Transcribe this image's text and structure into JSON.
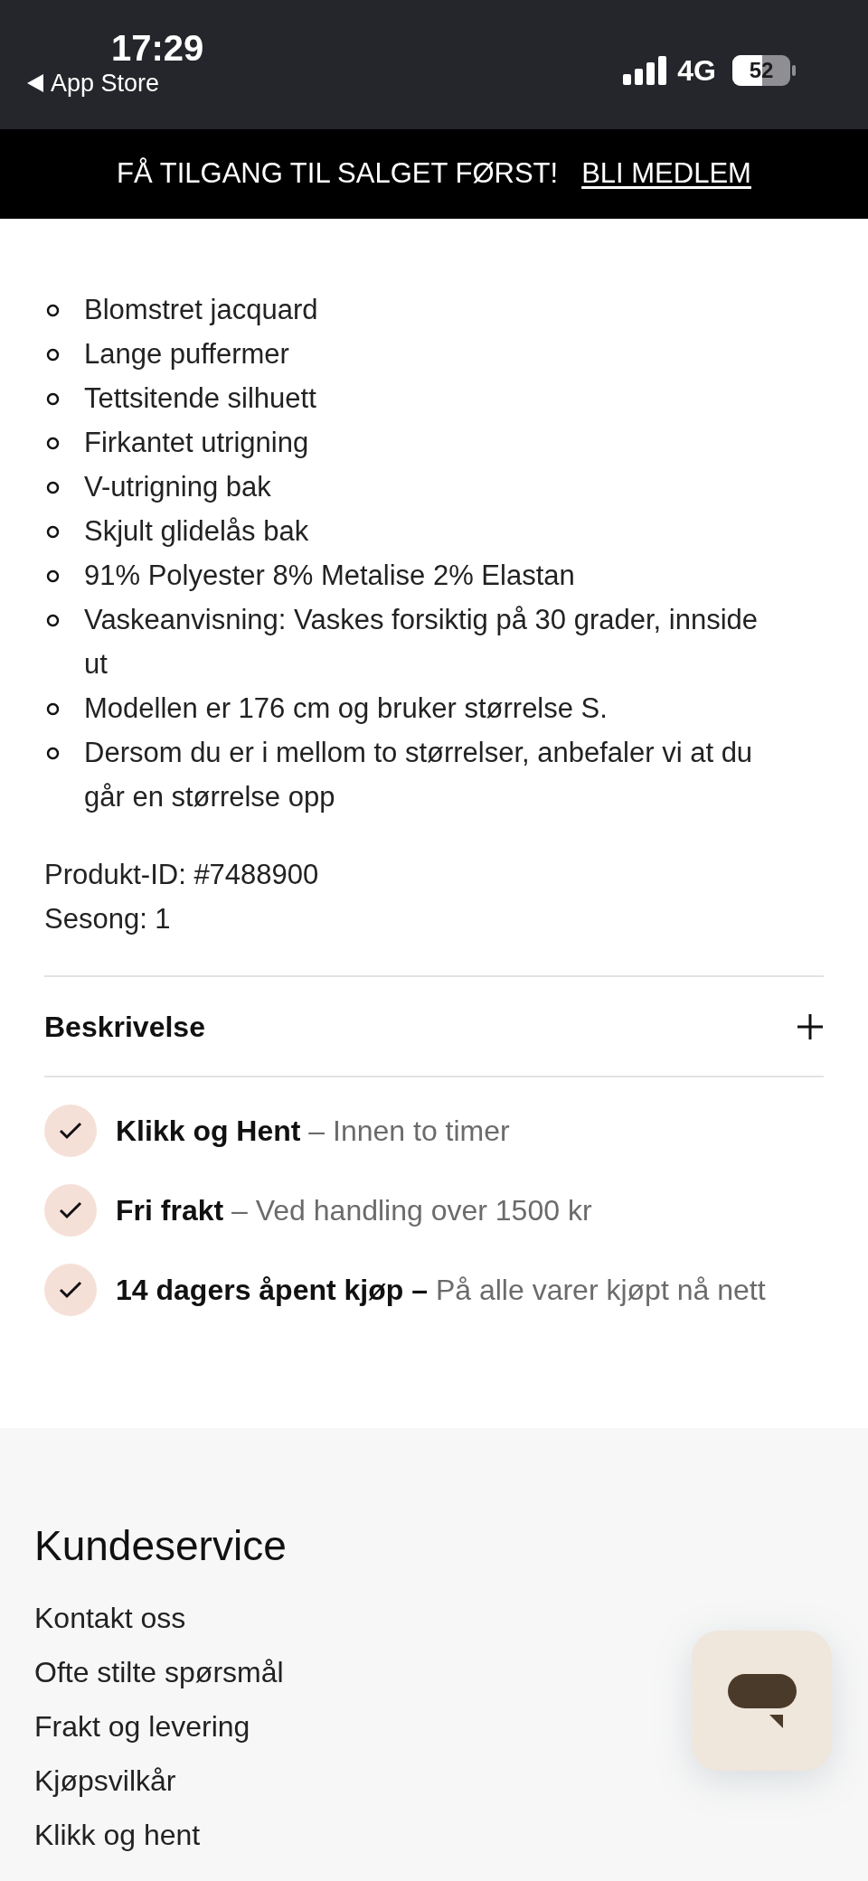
{
  "status_bar": {
    "time": "17:29",
    "back_label": "App Store",
    "network": "4G",
    "battery": "52"
  },
  "banner": {
    "text": "FÅ TILGANG TIL SALGET FØRST!",
    "link": "BLI MEDLEM"
  },
  "details": [
    "Blomstret jacquard",
    "Lange puffermer",
    "Tettsitende silhuett",
    "Firkantet utrigning",
    "V-utrigning bak",
    "Skjult glidelås bak",
    "91% Polyester 8% Metalise 2% Elastan",
    "Vaskeanvisning: Vaskes forsiktig på 30 grader, innside ut",
    "Modellen er 176 cm og bruker størrelse S.",
    "Dersom du er i mellom to størrelser, anbefaler vi at du går en størrelse opp"
  ],
  "meta": [
    "Produkt-ID: #7488900",
    "Sesong: 1"
  ],
  "accordion": {
    "title": "Beskrivelse",
    "expanded": false
  },
  "benefits": [
    {
      "title": "Klikk og Hent",
      "text": "– Innen to timer"
    },
    {
      "title": "Fri frakt",
      "text": "– Ved handling over 1500 kr"
    },
    {
      "title": "14 dagers åpent kjøp –",
      "text": "På alle varer kjøpt nå nett"
    }
  ],
  "footer": {
    "heading": "Kundeservice",
    "links": [
      "Kontakt oss",
      "Ofte stilte spørsmål",
      "Frakt og levering",
      "Kjøpsvilkår",
      "Klikk og hent"
    ]
  }
}
